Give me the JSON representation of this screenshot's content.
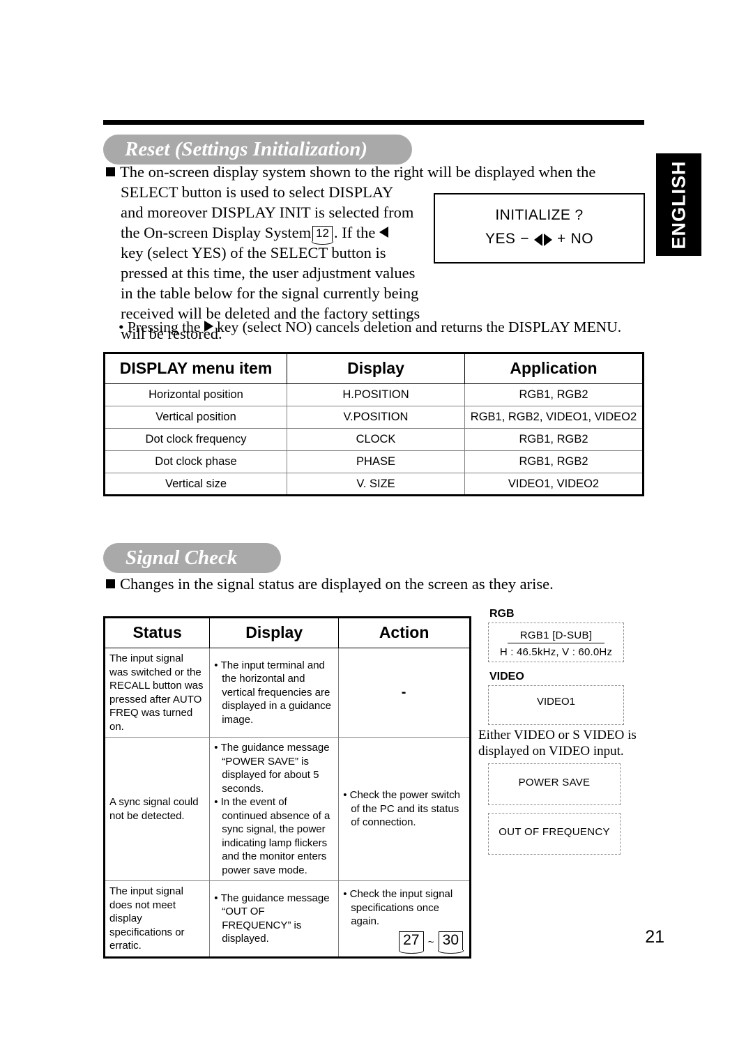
{
  "page": {
    "number": "21",
    "language_tab": "ENGLISH"
  },
  "sections": [
    {
      "banner": "Reset (Settings Initialization)",
      "intro": {
        "line1": "The on-screen display system shown to the right will be displayed when the",
        "line2": "SELECT button is used to select DISPLAY",
        "line3": "and moreover DISPLAY INIT is selected from",
        "line4a": "the On-screen Display System",
        "line4_ref": "12",
        "line4b": ". If the",
        "line5": "key (select YES) of the SELECT button is",
        "line6": "pressed at this time, the user adjustment values",
        "line7": "in the table below for the signal currently being",
        "line8": "received will be deleted and the factory settings",
        "line9": "will be restored."
      },
      "note": {
        "pre": "Pressing the",
        "post": "key (select NO) cancels deletion and returns the DISPLAY MENU."
      },
      "osd": {
        "title": "INITIALIZE ?",
        "yes": "YES",
        "minus": "−",
        "plus": "+",
        "no": "NO"
      }
    },
    {
      "banner": "Signal Check",
      "intro": "Changes in the signal status are displayed on the screen as they arise."
    }
  ],
  "table_display": {
    "headers": [
      "DISPLAY menu item",
      "Display",
      "Application"
    ],
    "rows": [
      [
        "Horizontal position",
        "H.POSITION",
        "RGB1, RGB2"
      ],
      [
        "Vertical position",
        "V.POSITION",
        "RGB1, RGB2, VIDEO1, VIDEO2"
      ],
      [
        "Dot clock frequency",
        "CLOCK",
        "RGB1, RGB2"
      ],
      [
        "Dot clock phase",
        "PHASE",
        "RGB1, RGB2"
      ],
      [
        "Vertical size",
        "V. SIZE",
        "VIDEO1, VIDEO2"
      ]
    ]
  },
  "table_signal": {
    "headers": [
      "Status",
      "Display",
      "Action"
    ],
    "rows": [
      {
        "status": "The input signal was switched or the RECALL button was pressed after AUTO FREQ was turned on.",
        "display_bullets": [
          "The input terminal and the horizontal and vertical frequencies are displayed in a guidance image."
        ],
        "action_bullets": [],
        "action_dash": "-"
      },
      {
        "status": "A sync signal could not be detected.",
        "display_bullets": [
          "The guidance message “POWER SAVE” is displayed for about 5 seconds.",
          "In the event of continued absence of a sync signal, the power indicating lamp flickers and the monitor enters power save mode."
        ],
        "action_bullets": [
          "Check the power switch of the PC and its status of connection."
        ]
      },
      {
        "status": "The input signal does not meet display specifications or erratic.",
        "display_bullets": [
          "The guidance message “OUT OF FREQUENCY” is displayed."
        ],
        "action_bullets": [
          "Check the input signal specifications once again."
        ],
        "action_ref_from": "27",
        "action_ref_sep": "~",
        "action_ref_to": "30"
      }
    ]
  },
  "osd_guidance": {
    "rgb_label": "RGB",
    "rgb_box_line1": "RGB1  [D-SUB]",
    "rgb_box_line2": "H : 46.5kHz, V : 60.0Hz",
    "video_label": "VIDEO",
    "video_box_line1": "VIDEO1",
    "note": "Either VIDEO or S VIDEO is displayed on VIDEO input.",
    "power_save_box": "POWER  SAVE",
    "out_of_frequency_box": "OUT OF FREQUENCY"
  },
  "colors": {
    "banner_gray": "#a9a9a9",
    "tab_black": "#000000",
    "rule_black": "#000000",
    "table_grid": "#7f7f7f",
    "osd_dash_border": "#8c8c8c"
  }
}
